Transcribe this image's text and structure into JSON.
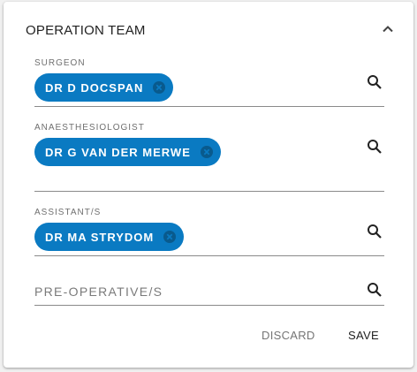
{
  "section": {
    "title": "OPERATION TEAM"
  },
  "fields": {
    "surgeon": {
      "label": "SURGEON",
      "chips": [
        "DR D DOCSPAN"
      ]
    },
    "anaesthesiologist": {
      "label": "ANAESTHESIOLOGIST",
      "chips": [
        "DR G VAN DER MERWE"
      ]
    },
    "assistants": {
      "label": "ASSISTANT/S",
      "chips": [
        "DR MA STRYDOM"
      ]
    },
    "pre_operatives": {
      "placeholder": "PRE-OPERATIVE/S",
      "value": ""
    }
  },
  "actions": {
    "discard_label": "DISCARD",
    "save_label": "SAVE"
  },
  "icons": {
    "collapse": "chevron-up-icon",
    "search": "search-icon",
    "chip_remove": "cancel-circle-icon"
  },
  "colors": {
    "chip_background": "#0a7ac2",
    "chip_text": "#ffffff",
    "discard_text": "#757575",
    "save_text": "#212121"
  }
}
